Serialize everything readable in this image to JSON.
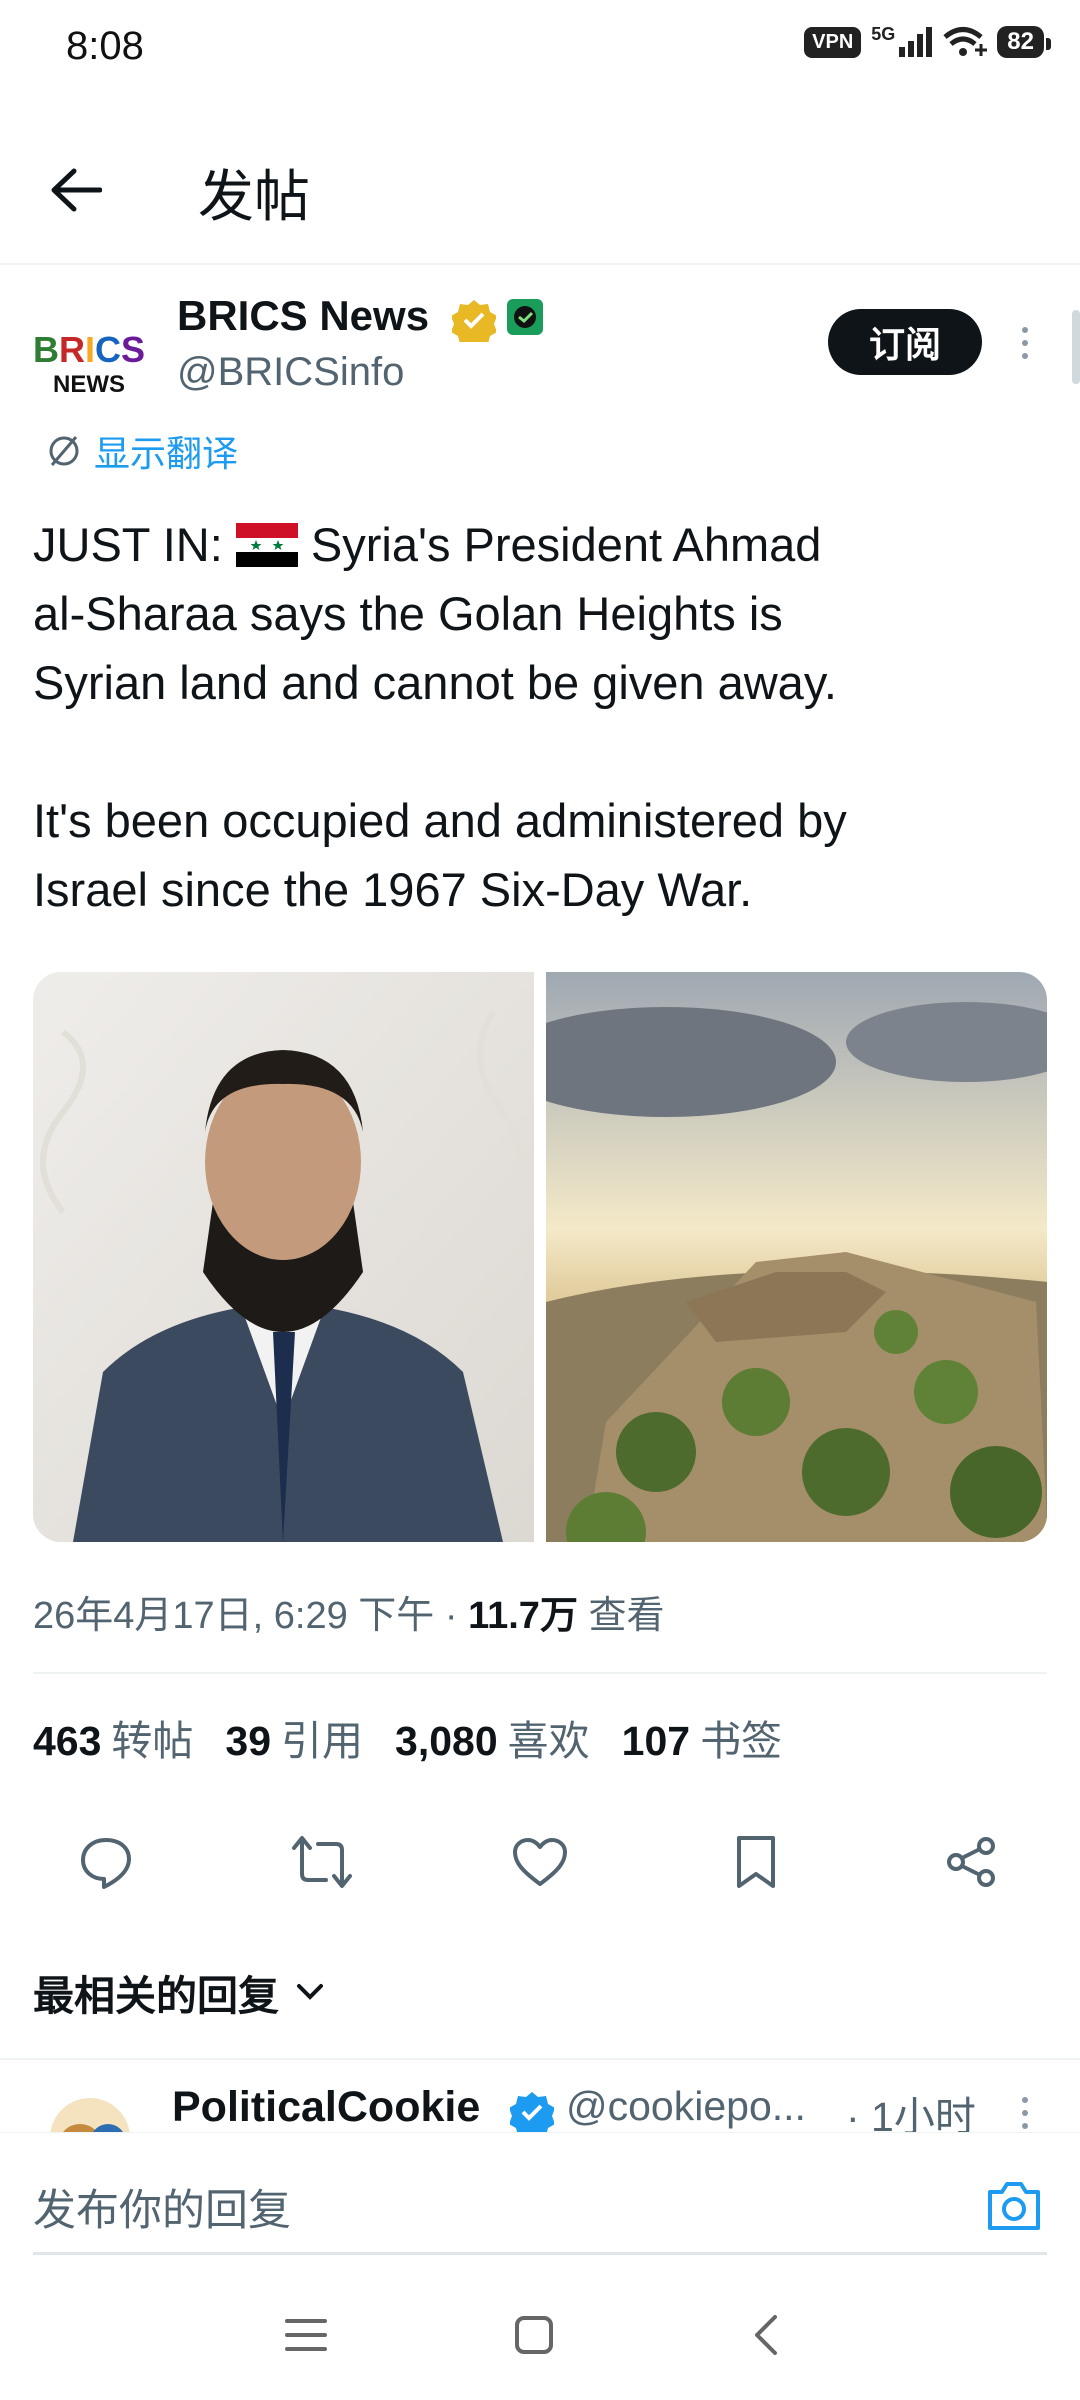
{
  "status_bar": {
    "time": "8:08",
    "vpn": "VPN",
    "network": "5G",
    "battery": "82"
  },
  "header": {
    "title": "发帖"
  },
  "tweet": {
    "author_name": "BRICS News",
    "author_handle": "@BRICSinfo",
    "avatar_text_top": "BRICS",
    "avatar_text_bottom": "NEWS",
    "subscribe_label": "订阅",
    "translate_label": "显示翻译",
    "text_line1_prefix": "JUST IN: ",
    "text_line1_suffix": " Syria's President Ahmad",
    "text_rest": "al-Sharaa says the Golan Heights is\nSyrian land and cannot be given away.\n\nIt's been occupied and administered by\nIsrael since the 1967 Six-Day War.",
    "timestamp": "26年4月17日, 6:29 下午 · ",
    "views_count": "11.7万",
    "views_label": " 查看",
    "stats": [
      {
        "count": "463",
        "label": "转帖"
      },
      {
        "count": "39",
        "label": "引用"
      },
      {
        "count": "3,080",
        "label": "喜欢"
      },
      {
        "count": "107",
        "label": "书签"
      }
    ]
  },
  "replies": {
    "heading": "最相关的回复",
    "first_reply": {
      "name": "PoliticalCookie",
      "handle": "@cookiepo...",
      "time": "· 1小时"
    }
  },
  "compose": {
    "placeholder": "发布你的回复"
  },
  "colors": {
    "accent": "#1d9bf0",
    "text": "#0f1419",
    "secondary": "#536471",
    "verified_gold": "#e8b825"
  }
}
